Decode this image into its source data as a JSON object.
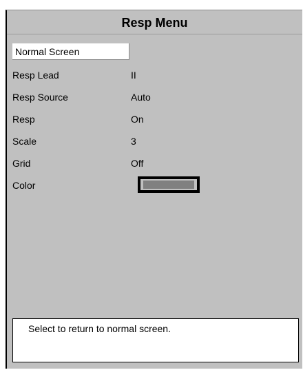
{
  "window": {
    "title": "Resp Menu"
  },
  "menu": {
    "items": [
      {
        "label": "Normal Screen",
        "value": ""
      },
      {
        "label": "Resp Lead",
        "value": "II"
      },
      {
        "label": "Resp Source",
        "value": "Auto"
      },
      {
        "label": "Resp",
        "value": "On"
      },
      {
        "label": "Scale",
        "value": "3"
      },
      {
        "label": "Grid",
        "value": "Off"
      },
      {
        "label": "Color",
        "value": ""
      }
    ],
    "color_swatch": "#808080"
  },
  "help": {
    "text": "Select to return to normal screen."
  },
  "colors": {
    "background": "#c0c0c0",
    "selected": "#ffffff",
    "border": "#000000"
  }
}
